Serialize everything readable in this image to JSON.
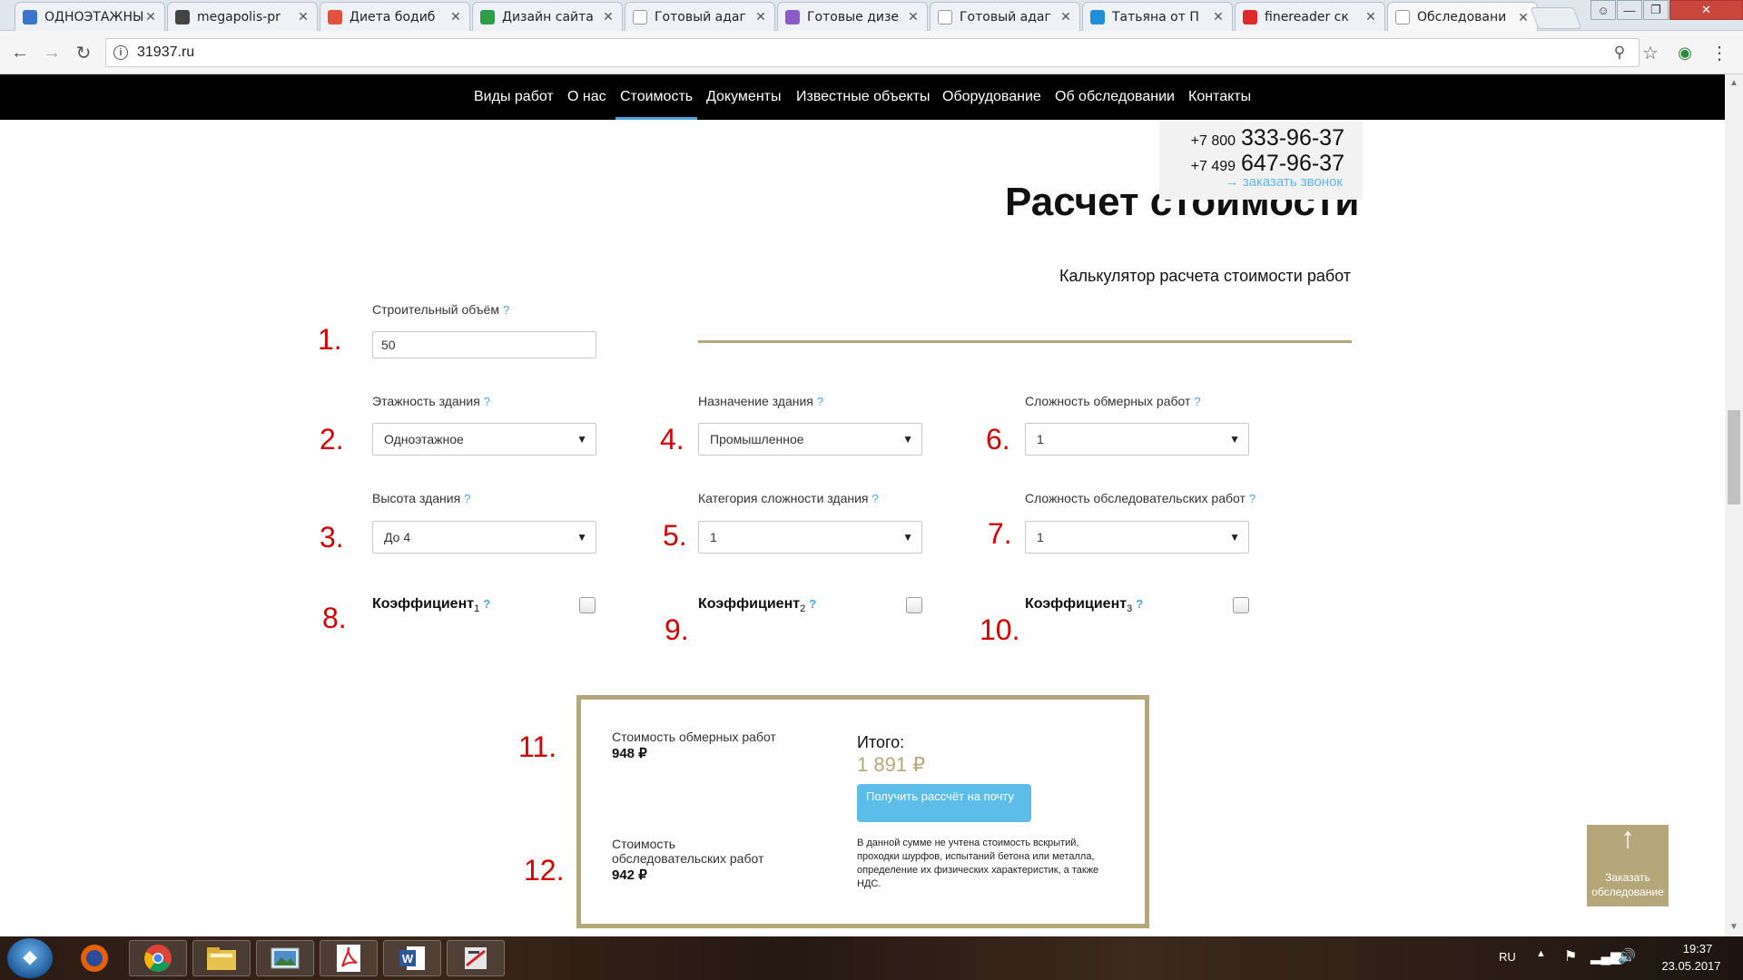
{
  "browser": {
    "tabs": [
      {
        "title": "ОДНОЭТАЖНЫ",
        "icon_color": "#3b77c9",
        "icon": "doc-icon"
      },
      {
        "title": "megapolis-pr",
        "icon_color": "#444444",
        "icon": "site-icon"
      },
      {
        "title": "Диета бодиб",
        "icon_color": "#e0523c",
        "icon": "site-icon"
      },
      {
        "title": "Дизайн сайта",
        "icon_color": "#2f9e4b",
        "icon": "site-icon"
      },
      {
        "title": "Готовый адаг",
        "icon_color": "#ffffff",
        "icon": "page-icon"
      },
      {
        "title": "Готовые дизе",
        "icon_color": "#8a5cc8",
        "icon": "site-icon"
      },
      {
        "title": "Готовый адаг",
        "icon_color": "#ffffff",
        "icon": "page-icon"
      },
      {
        "title": "Татьяна от П",
        "icon_color": "#1f8fd6",
        "icon": "site-icon"
      },
      {
        "title": "finereader ск",
        "icon_color": "#e02a2a",
        "icon": "yandex-icon"
      },
      {
        "title": "Обследовани",
        "icon_color": "#ffffff",
        "icon": "page-icon"
      }
    ],
    "url": "31937.ru"
  },
  "site_nav": {
    "items": [
      "Виды работ",
      "О нас",
      "Стоимость",
      "Документы",
      "Известные объекты",
      "Оборудование",
      "Об обследовании",
      "Контакты"
    ],
    "active": "Стоимость"
  },
  "contacts": {
    "phone1_prefix": "+7 800",
    "phone1": "333-96-37",
    "phone2_prefix": "+7 499",
    "phone2": "647-96-37",
    "callback": "→ заказать звонок"
  },
  "calculator": {
    "title": "Расчет стоимости",
    "subtitle": "Калькулятор расчета стоимости работ",
    "help": "?",
    "volume": {
      "label": "Строительный объём",
      "value": "50",
      "num": "1."
    },
    "floors": {
      "label": "Этажность здания",
      "value": "Одноэтажное",
      "num": "2."
    },
    "height": {
      "label": "Высота здания",
      "value": "До 4",
      "num": "3."
    },
    "purpose": {
      "label": "Назначение здания",
      "value": "Промышленное",
      "num": "4."
    },
    "category": {
      "label": "Категория сложности здания",
      "value": "1",
      "num": "5."
    },
    "measure_complexity": {
      "label": "Сложность обмерных работ",
      "value": "1",
      "num": "6."
    },
    "survey_complexity": {
      "label": "Сложность обследовательских работ",
      "value": "1",
      "num": "7."
    },
    "coef1": {
      "label": "Коэффициент",
      "sub": "1",
      "num": "8.",
      "checked": false
    },
    "coef2": {
      "label": "Коэффициент",
      "sub": "2",
      "num": "9.",
      "checked": false
    },
    "coef3": {
      "label": "Коэффициент",
      "sub": "3",
      "num": "10.",
      "checked": false
    }
  },
  "result": {
    "measure_label": "Стоимость обмерных работ",
    "measure_value": "948 ₽",
    "measure_num": "11.",
    "survey_label_1": "Стоимость",
    "survey_label_2": "обследовательских работ",
    "survey_value": "942 ₽",
    "survey_num": "12.",
    "total_label": "Итого:",
    "total_value": "1 891 ₽",
    "mail_button": "Получить рассчёт на почту",
    "note": "В данной сумме не учтена стоимость вскрытий, проходки шурфов, испытаний бетона или металла, определение их физических характеристик, а также НДС."
  },
  "order_button": {
    "label": "Заказать обследование",
    "icon": "arrow-up-icon"
  },
  "colors": {
    "accent_gold": "#b6a77a",
    "accent_blue": "#5bbde8",
    "annotation_red": "#d40000"
  },
  "taskbar": {
    "apps": [
      "firefox-icon",
      "chrome-icon",
      "explorer-icon",
      "photo-viewer-icon",
      "acrobat-icon",
      "word-icon",
      "app-icon"
    ],
    "language": "RU",
    "time": "19:37",
    "date": "23.05.2017"
  }
}
